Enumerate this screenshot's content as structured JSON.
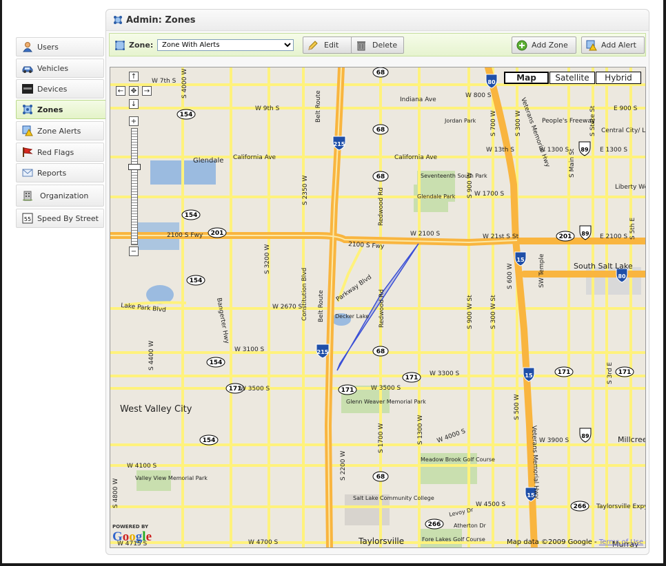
{
  "header": {
    "title": "Admin: Zones"
  },
  "sidebar": {
    "items": [
      {
        "label": "Users",
        "icon": "user-icon"
      },
      {
        "label": "Vehicles",
        "icon": "car-icon"
      },
      {
        "label": "Devices",
        "icon": "device-icon"
      },
      {
        "label": "Zones",
        "icon": "zone-icon",
        "active": true
      },
      {
        "label": "Zone Alerts",
        "icon": "zone-alert-icon"
      },
      {
        "label": "Red Flags",
        "icon": "flag-icon"
      },
      {
        "label": "Reports",
        "icon": "envelope-icon"
      },
      {
        "label": "Organization",
        "icon": "building-icon"
      },
      {
        "label": "Speed By Street",
        "icon": "speed-sign-icon"
      }
    ]
  },
  "toolbar": {
    "zone_label": "Zone:",
    "zone_select_value": "Zone With Alerts",
    "edit_label": "Edit",
    "delete_label": "Delete",
    "add_zone_label": "Add Zone",
    "add_alert_label": "Add Alert"
  },
  "map": {
    "types": [
      "Map",
      "Satellite",
      "Hybrid"
    ],
    "selected_type": "Map",
    "nav": {
      "up": "↑",
      "down": "↓",
      "left": "←",
      "right": "→",
      "center": "✥",
      "zoom_in": "+",
      "zoom_out": "−"
    },
    "attribution": "Map data ©2009 Google -",
    "terms": "Terms of Use",
    "powered_by": "POWERED BY",
    "logo": "Google",
    "colors": {
      "land": "#ece8df",
      "highway": "#f9b53f",
      "arterial": "#fff27c",
      "water": "#9bbbe0",
      "park": "#c9dfaf",
      "zone": "#3a4fd6"
    },
    "labels": [
      "W 7th S",
      "W 9th S",
      "Indiana Ave",
      "California Ave",
      "Glendale",
      "Seventeenth South Park",
      "Glendale Park",
      "W 1700 S",
      "W 2100 S",
      "2100 S Fwy",
      "W 21st S St",
      "Lake Park Blvd",
      "W 2670 S",
      "Parkway Blvd",
      "Decker Lake",
      "W 3100 S",
      "W 3300 S",
      "W 3500 S",
      "Glenn Weaver Memorial Park",
      "West Valley City",
      "W 3900 S",
      "W 4000 S",
      "Meadow Brook Golf Course",
      "W 4100 S",
      "Valley View Memorial Park",
      "W 4500 S",
      "W 4700 S",
      "Salt Lake Community College",
      "Taylorsville",
      "Levoy Dr",
      "Atherton Dr",
      "Fore Lakes Golf Course",
      "Taylorsville Expy",
      "Jordan Park",
      "People's Freeway",
      "W 13th S",
      "Central City/ Liberty Wells",
      "Liberty Wells",
      "South Salt Lake",
      "E 2100 S",
      "E 1300 S",
      "W 800 S",
      "Millcreek",
      "Belt Route",
      "Redwood Rd",
      "Bangerter Hwy",
      "Veterans Memorial Hwy",
      "Constitution Blvd",
      "S 4000 W",
      "S 3200 W",
      "S 2350 W",
      "S 900 W",
      "S 700 W",
      "S 300 W",
      "Murray",
      "E 900 S",
      "W 1300 S",
      "S 4400 W",
      "S 4800 W",
      "W 4715 S",
      "S 1300 W",
      "S 1700 W",
      "S 2200 W",
      "S 500 W",
      "S 600 W",
      "S 900 W St",
      "S 300 W St",
      "S Main St",
      "S State St",
      "SW Temple",
      "S 5th E",
      "S 3rd E",
      "W 3500 S St"
    ],
    "shields": [
      "68",
      "154",
      "201",
      "215",
      "171",
      "80",
      "89",
      "15",
      "266"
    ]
  }
}
